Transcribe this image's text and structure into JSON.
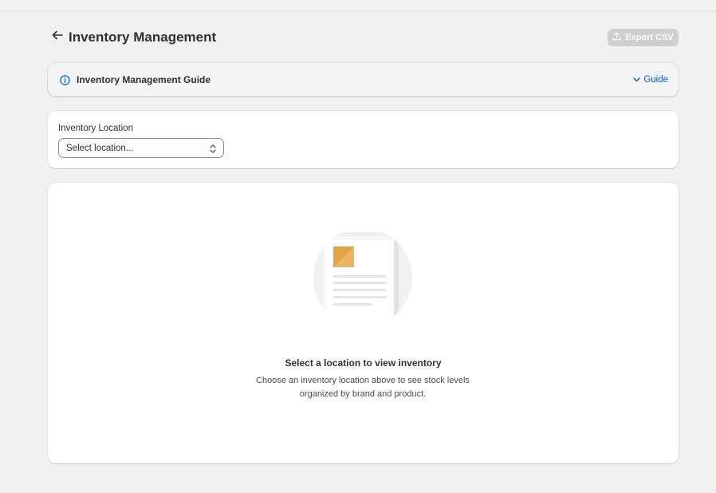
{
  "header": {
    "title": "Inventory Management",
    "back_icon": "arrow-left-icon",
    "export_label": "Export CSV",
    "export_icon": "upload-icon"
  },
  "guide": {
    "title": "Inventory Management Guide",
    "toggle_label": "Guide",
    "icon": "info-icon",
    "toggle_icon": "chevron-down-icon"
  },
  "location": {
    "label": "Inventory Location",
    "select_value": "Select location..."
  },
  "empty_state": {
    "heading": "Select a location to view inventory",
    "body": "Choose an inventory location above to see stock levels organized by brand and product.",
    "illustration": "document-illustration"
  },
  "colors": {
    "background": "#f1f1f1",
    "card": "#ffffff",
    "link": "#005bd3",
    "disabled_button": "#cfcfcf",
    "illustration_accent": "#e3a447"
  }
}
